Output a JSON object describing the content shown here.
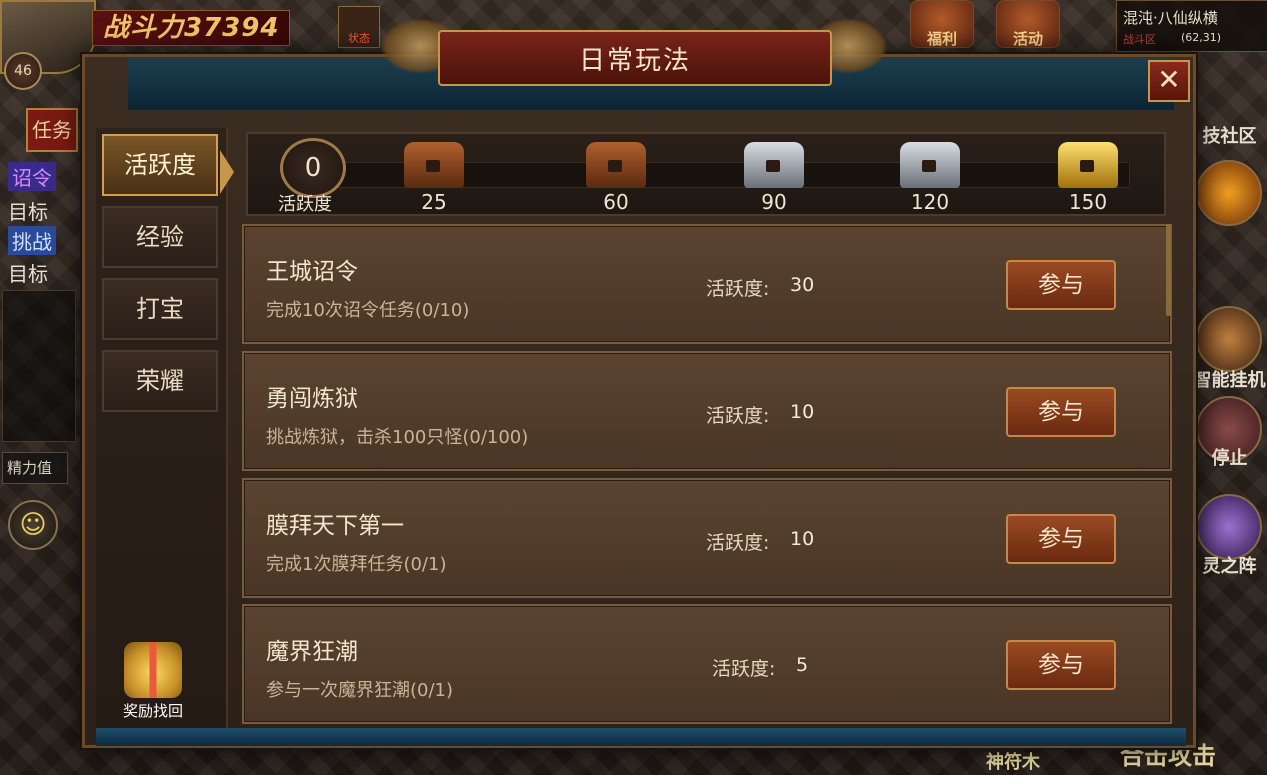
{
  "hud": {
    "combat_power": "战斗力37394",
    "level": "46",
    "status_label": "状态",
    "zone_name": "混沌·八仙纵横",
    "zone_sub": "战斗区",
    "zone_coord": "(62,31)",
    "top_icons": [
      "福利",
      "活动"
    ],
    "left_strip": {
      "task_btn": "任务",
      "items": [
        "诏令",
        "目标",
        "挑战",
        "目标"
      ],
      "energy": "精力值"
    },
    "right_items": [
      "技社区",
      "智能挂机",
      "停止",
      "灵之阵"
    ],
    "bottom_texts": [
      "神符木",
      "合击攻击"
    ]
  },
  "dialog": {
    "title": "日常玩法",
    "close_label": "✕",
    "tabs": [
      {
        "label": "活跃度",
        "active": true
      },
      {
        "label": "经验",
        "active": false
      },
      {
        "label": "打宝",
        "active": false
      },
      {
        "label": "荣耀",
        "active": false
      }
    ],
    "reward_recover_label": "奖励找回",
    "activity": {
      "current": "0",
      "label": "活跃度",
      "progress": 0,
      "milestones": [
        {
          "value": "25",
          "tier": "bronze"
        },
        {
          "value": "60",
          "tier": "bronze"
        },
        {
          "value": "90",
          "tier": "silver"
        },
        {
          "value": "120",
          "tier": "silver"
        },
        {
          "value": "150",
          "tier": "gold"
        }
      ]
    },
    "tasks": [
      {
        "name": "王城诏令",
        "desc": "完成10次诏令任务(0/10)",
        "activity_label": "活跃度:",
        "activity_value": "30",
        "button": "参与"
      },
      {
        "name": "勇闯炼狱",
        "desc": "挑战炼狱，击杀100只怪(0/100)",
        "activity_label": "活跃度:",
        "activity_value": "10",
        "button": "参与"
      },
      {
        "name": "膜拜天下第一",
        "desc": "完成1次膜拜任务(0/1)",
        "activity_label": "活跃度:",
        "activity_value": "10",
        "button": "参与"
      },
      {
        "name": "魔界狂潮",
        "desc": "参与一次魔界狂潮(0/1)",
        "activity_label": "活跃度:",
        "activity_value": "5",
        "button": "参与"
      }
    ]
  },
  "colors": {
    "accent_gold": "#c8964a",
    "title_red": "#7a2418",
    "bronze": "#8a4a22",
    "silver": "#9aa0a8",
    "gold": "#e0b030"
  }
}
